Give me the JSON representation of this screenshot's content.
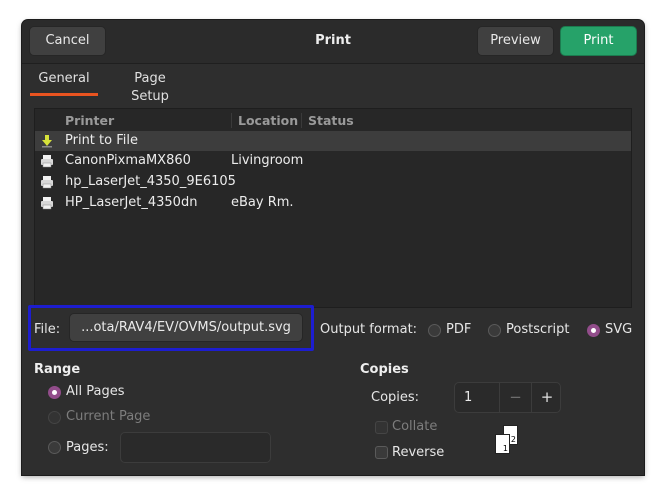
{
  "header": {
    "title": "Print",
    "cancel_label": "Cancel",
    "preview_label": "Preview",
    "print_label": "Print"
  },
  "tabs": [
    {
      "label": "General",
      "active": true
    },
    {
      "label": "Page Setup",
      "active": false
    }
  ],
  "printer_list": {
    "columns": {
      "printer": "Printer",
      "location": "Location",
      "status": "Status"
    },
    "rows": [
      {
        "icon": "download-arrow-icon",
        "name": "Print to File",
        "location": "",
        "selected": true
      },
      {
        "icon": "printer-icon",
        "name": "CanonPixmaMX860",
        "location": "Livingroom",
        "selected": false
      },
      {
        "icon": "printer-icon",
        "name": "hp_LaserJet_4350_9E6105",
        "location": "",
        "selected": false
      },
      {
        "icon": "printer-icon",
        "name": "HP_LaserJet_4350dn",
        "location": "eBay Rm.",
        "selected": false
      }
    ]
  },
  "file": {
    "label": "File:",
    "value": "...ota/RAV4/EV/OVMS/output.svg"
  },
  "output_format": {
    "label": "Output format:",
    "options": [
      {
        "label": "PDF",
        "selected": false
      },
      {
        "label": "Postscript",
        "selected": false
      },
      {
        "label": "SVG",
        "selected": true
      }
    ]
  },
  "range": {
    "title": "Range",
    "all_pages": "All Pages",
    "current_page": "Current Page",
    "pages": "Pages:",
    "pages_value": ""
  },
  "copies": {
    "title": "Copies",
    "copies_label": "Copies:",
    "copies_value": "1",
    "minus": "−",
    "plus": "+",
    "collate": "Collate",
    "reverse": "Reverse",
    "page_front": "1",
    "page_back": "2"
  },
  "colors": {
    "accent": "#e95420",
    "print_button": "#26a269",
    "radio_selected": "#924d8b",
    "highlight_box": "#1d1dcf"
  }
}
